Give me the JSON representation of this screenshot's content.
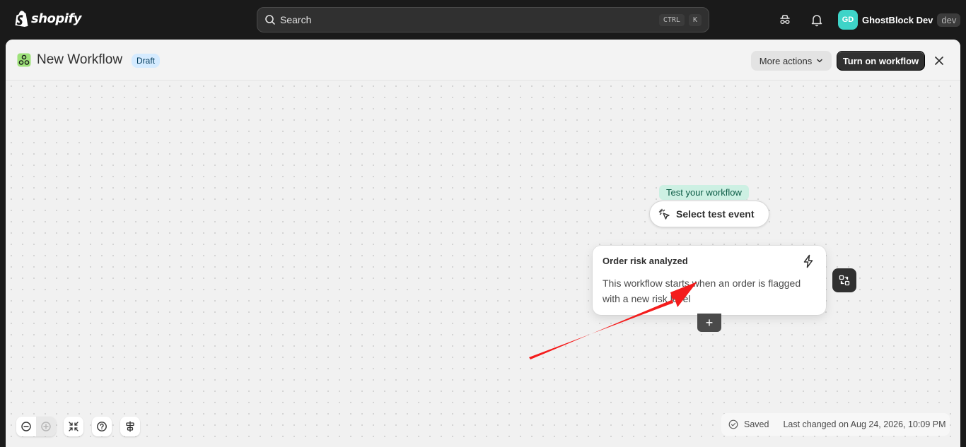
{
  "topbar": {
    "brand": "shopify",
    "search": {
      "placeholder": "Search",
      "shortcut_key1": "CTRL",
      "shortcut_key2": "K"
    },
    "account": {
      "initials": "GD",
      "name": "GhostBlock Dev",
      "store_tag": "dev",
      "avatar_color": "#3ed4c8"
    }
  },
  "header": {
    "title": "New Workflow",
    "status_badge": "Draft",
    "more_actions_label": "More actions",
    "primary_button_label": "Turn on workflow"
  },
  "canvas": {
    "test_label": "Test your workflow",
    "select_test_label": "Select test event",
    "trigger": {
      "title": "Order risk analyzed",
      "description": "This workflow starts when an order is flagged with a new risk level",
      "icon": "bolt-icon"
    },
    "add_step_label": "+",
    "annotation_arrow_color": "#f41c1c"
  },
  "footer": {
    "saved_label": "Saved",
    "last_changed": "Last changed on Aug 24, 2026, 10:09 PM"
  },
  "colors": {
    "topbar_bg": "#1a1a1a",
    "primary_button": "#303030",
    "draft_badge_bg": "#d5ebff",
    "test_label_bg": "#cdf0e3"
  }
}
